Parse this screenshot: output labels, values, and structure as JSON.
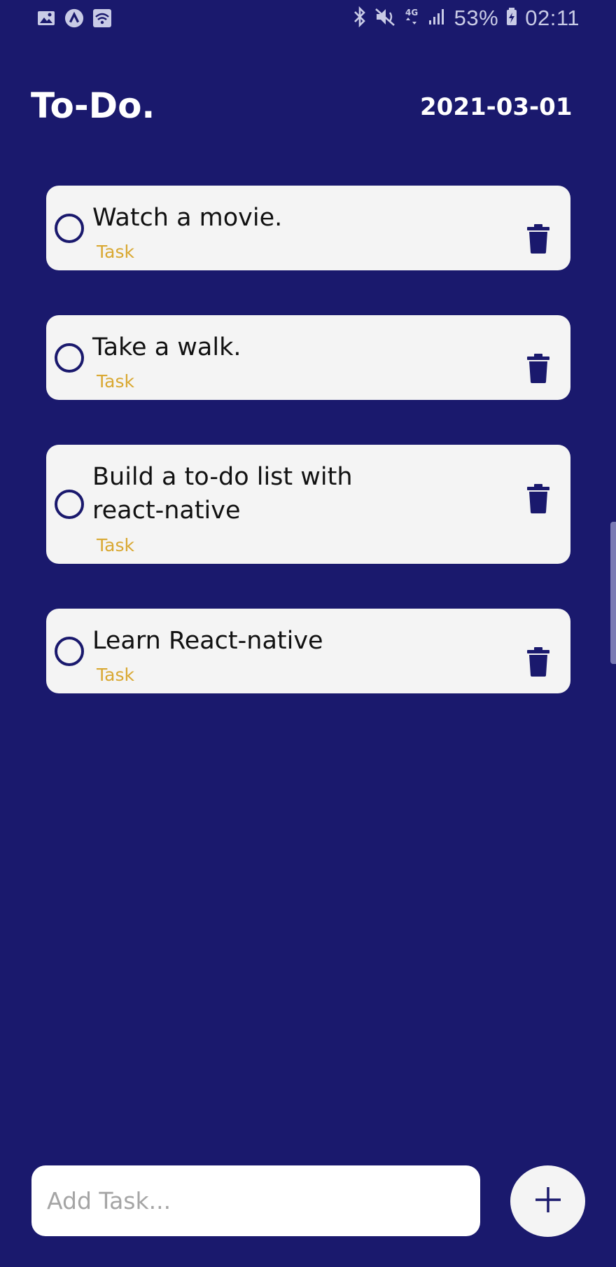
{
  "status_bar": {
    "left_icons": [
      "image-icon",
      "app-icon",
      "wifi-icon"
    ],
    "right_icons": [
      "bluetooth-icon",
      "mute-icon",
      "4g-icon",
      "signal-icon"
    ],
    "battery_percent": "53%",
    "time": "02:11"
  },
  "header": {
    "title": "To-Do.",
    "date": "2021-03-01"
  },
  "tasks": [
    {
      "text": "Watch a movie.",
      "tag": "Task"
    },
    {
      "text": "Take a walk.",
      "tag": "Task"
    },
    {
      "text": "Build a to-do list with react-native",
      "tag": "Task"
    },
    {
      "text": "Learn React-native",
      "tag": "Task"
    }
  ],
  "input": {
    "placeholder": "Add Task..."
  },
  "colors": {
    "background": "#1a196d",
    "card": "#f4f4f4",
    "tag": "#d9a832"
  }
}
